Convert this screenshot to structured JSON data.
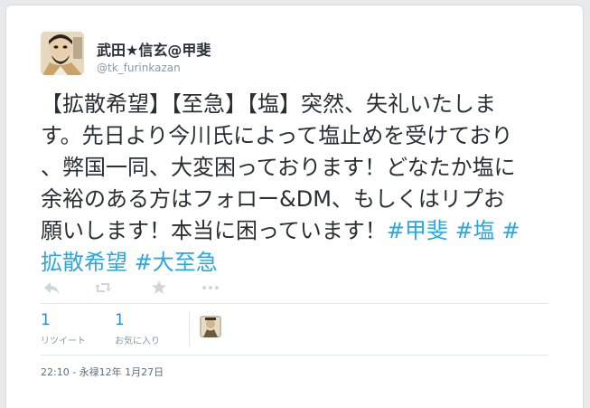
{
  "user": {
    "display_name": "武田★信玄@甲斐",
    "screen_name": "@tk_furinkazan",
    "avatar_icon": "samurai-portrait-avatar"
  },
  "tweet": {
    "lines": [
      [
        {
          "text": "【拡散希望】【至急】【塩】突然、失礼いたしま",
          "tag": false
        }
      ],
      [
        {
          "text": "す。先日より今川氏によって塩止めを受けており",
          "tag": false
        }
      ],
      [
        {
          "text": "、弊国一同、大変困っております！どなたか塩に",
          "tag": false
        }
      ],
      [
        {
          "text": "余裕のある方はフォロー&DM、もしくはリプお",
          "tag": false
        }
      ],
      [
        {
          "text": "願いします！本当に困っています！",
          "tag": false
        },
        {
          "text": "#甲斐",
          "tag": true
        },
        {
          "text": " ",
          "tag": false
        },
        {
          "text": "#塩",
          "tag": true
        },
        {
          "text": " ",
          "tag": false
        },
        {
          "text": "#",
          "tag": true
        }
      ],
      [
        {
          "text": "拡散希望",
          "tag": true
        },
        {
          "text": " ",
          "tag": false
        },
        {
          "text": "#大至急",
          "tag": true
        }
      ]
    ],
    "hashtag_color": "#2aa7e0"
  },
  "actions": [
    {
      "name": "reply-icon"
    },
    {
      "name": "retweet-icon"
    },
    {
      "name": "favorite-star-icon"
    },
    {
      "name": "more-dots-icon"
    }
  ],
  "stats": {
    "retweets": {
      "count": "1",
      "label": "リツイート"
    },
    "favorites": {
      "count": "1",
      "label": "お気に入り"
    }
  },
  "timestamp": "22:10 - 永禄12年 1月27日"
}
